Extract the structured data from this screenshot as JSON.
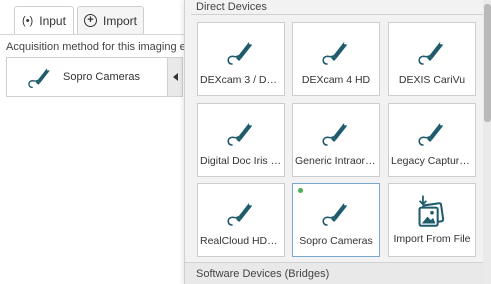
{
  "tabs": {
    "input_label": "Input",
    "import_label": "Import"
  },
  "acquisition_label": "Acquisition method for this imaging exam",
  "selected_device": {
    "name": "Sopro Cameras",
    "icon": "intraoral-camera-icon"
  },
  "panel": {
    "direct_devices_header": "Direct Devices",
    "software_devices_header": "Software Devices (Bridges)",
    "devices": [
      {
        "label": "DEXcam 3 / DEX...",
        "icon": "intraoral-camera-icon",
        "selected": false
      },
      {
        "label": "DEXcam 4 HD",
        "icon": "intraoral-camera-icon",
        "selected": false
      },
      {
        "label": "DEXIS CariVu",
        "icon": "intraoral-camera-icon",
        "selected": false
      },
      {
        "label": "Digital Doc Iris /...",
        "icon": "intraoral-camera-icon",
        "selected": false
      },
      {
        "label": "Generic Intraora...",
        "icon": "intraoral-camera-icon",
        "selected": false
      },
      {
        "label": "Legacy Capture ...",
        "icon": "intraoral-camera-icon",
        "selected": false
      },
      {
        "label": "RealCloud HD1 ...",
        "icon": "intraoral-camera-icon",
        "selected": false
      },
      {
        "label": "Sopro Cameras",
        "icon": "intraoral-camera-icon",
        "selected": true
      },
      {
        "label": "Import From File",
        "icon": "import-images-icon",
        "selected": false
      }
    ]
  },
  "colors": {
    "icon_teal": "#1f5c6b",
    "selected_border": "#7ba6cf",
    "status_green": "#4caf50"
  }
}
